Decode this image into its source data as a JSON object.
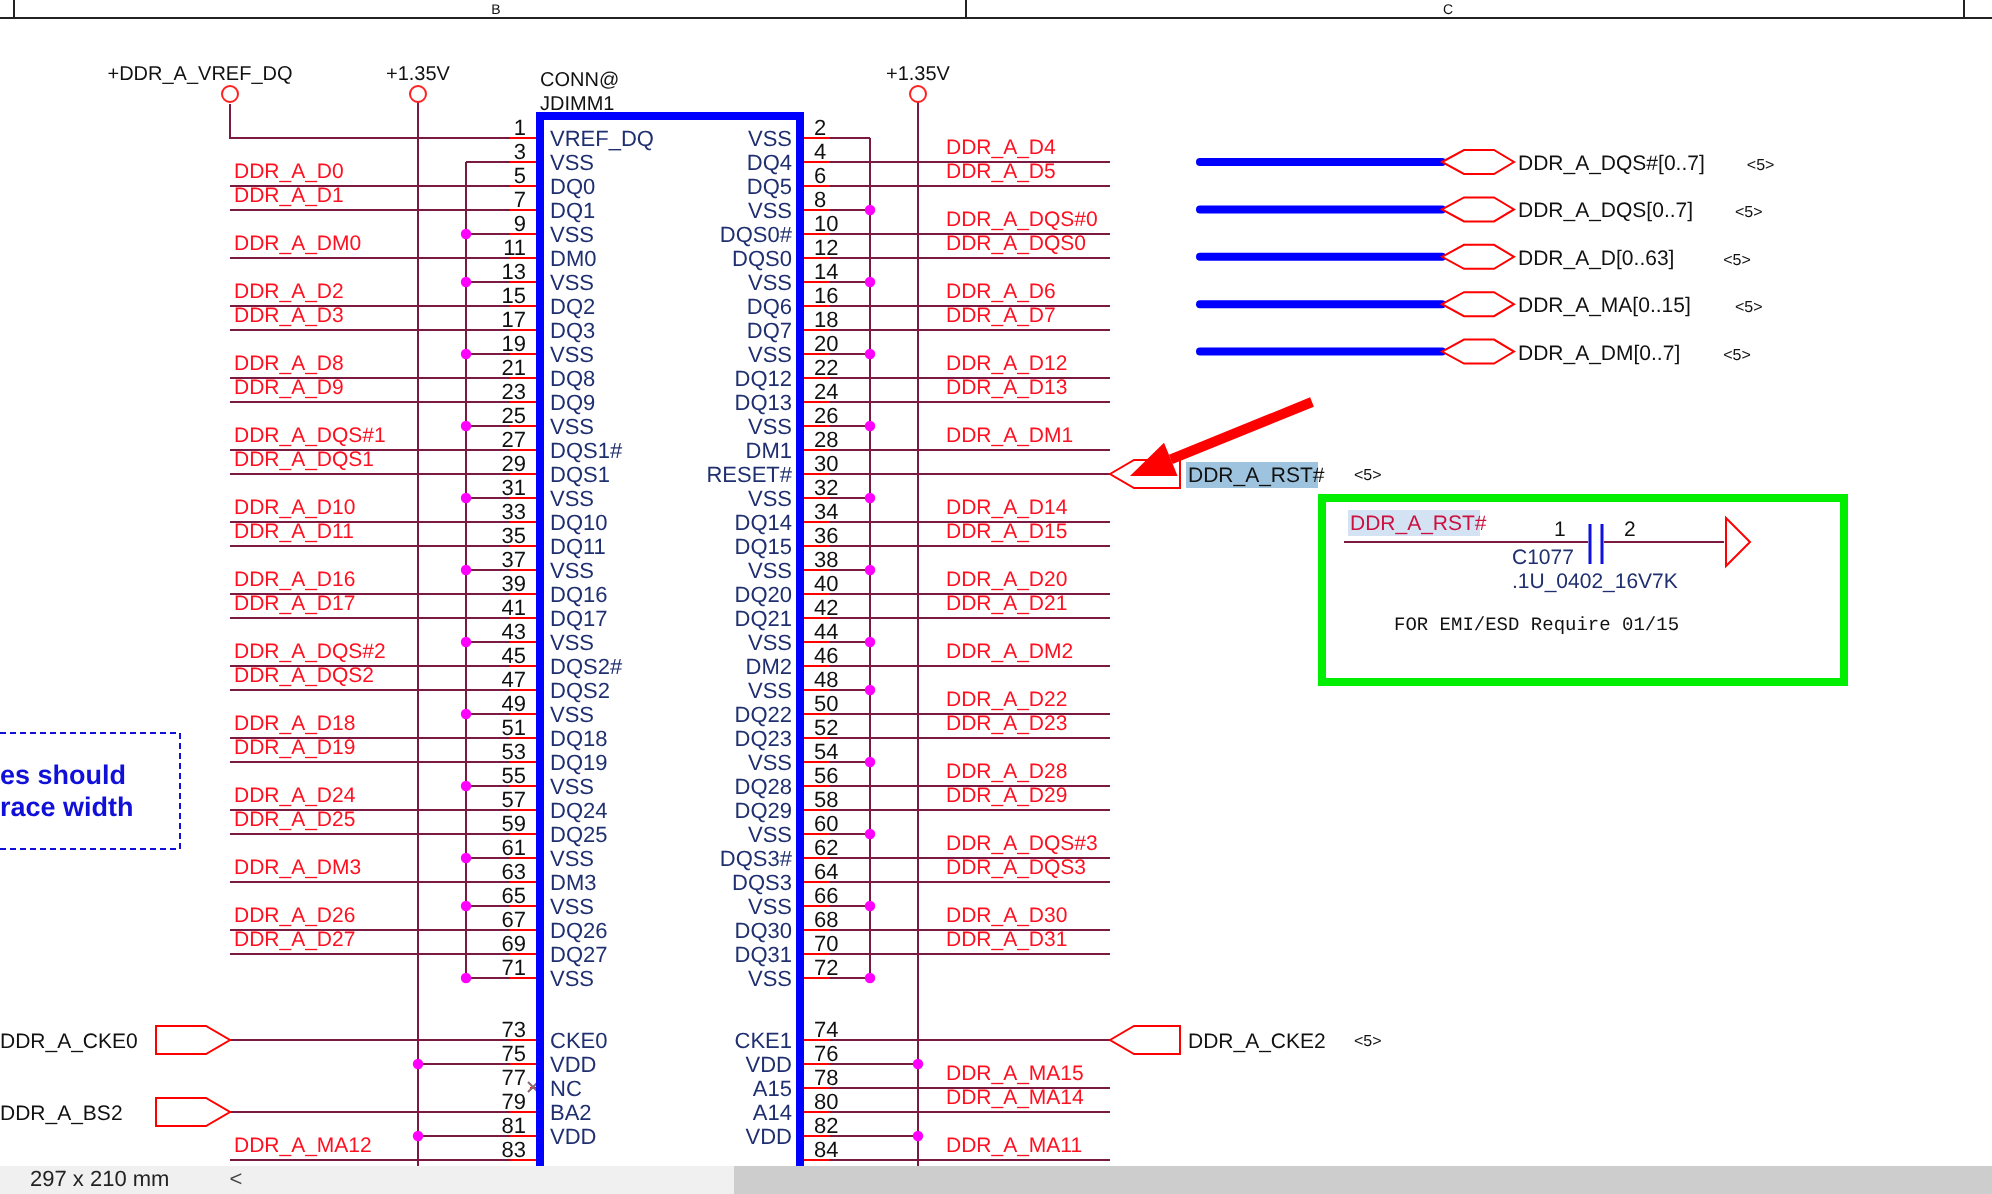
{
  "sheet": {
    "column_headers": [
      "B",
      "C"
    ]
  },
  "component": {
    "ref_tag": "CONN@",
    "designator": "JDIMM1"
  },
  "rails": [
    {
      "kind": "vref",
      "label": "+DDR_A_VREF_DQ"
    },
    {
      "kind": "power",
      "label": "+1.35V"
    },
    {
      "kind": "power",
      "label": "+1.35V"
    }
  ],
  "left_pins": [
    {
      "number": "1",
      "name": "VREF_DQ",
      "kind": "vref"
    },
    {
      "number": "3",
      "name": "VSS",
      "kind": "vss"
    },
    {
      "number": "5",
      "name": "DQ0",
      "kind": "net",
      "net": "DDR_A_D0"
    },
    {
      "number": "7",
      "name": "DQ1",
      "kind": "net",
      "net": "DDR_A_D1"
    },
    {
      "number": "9",
      "name": "VSS",
      "kind": "vss"
    },
    {
      "number": "11",
      "name": "DM0",
      "kind": "net",
      "net": "DDR_A_DM0"
    },
    {
      "number": "13",
      "name": "VSS",
      "kind": "vss"
    },
    {
      "number": "15",
      "name": "DQ2",
      "kind": "net",
      "net": "DDR_A_D2"
    },
    {
      "number": "17",
      "name": "DQ3",
      "kind": "net",
      "net": "DDR_A_D3"
    },
    {
      "number": "19",
      "name": "VSS",
      "kind": "vss"
    },
    {
      "number": "21",
      "name": "DQ8",
      "kind": "net",
      "net": "DDR_A_D8"
    },
    {
      "number": "23",
      "name": "DQ9",
      "kind": "net",
      "net": "DDR_A_D9"
    },
    {
      "number": "25",
      "name": "VSS",
      "kind": "vss"
    },
    {
      "number": "27",
      "name": "DQS1#",
      "kind": "net",
      "net": "DDR_A_DQS#1"
    },
    {
      "number": "29",
      "name": "DQS1",
      "kind": "net",
      "net": "DDR_A_DQS1"
    },
    {
      "number": "31",
      "name": "VSS",
      "kind": "vss"
    },
    {
      "number": "33",
      "name": "DQ10",
      "kind": "net",
      "net": "DDR_A_D10"
    },
    {
      "number": "35",
      "name": "DQ11",
      "kind": "net",
      "net": "DDR_A_D11"
    },
    {
      "number": "37",
      "name": "VSS",
      "kind": "vss"
    },
    {
      "number": "39",
      "name": "DQ16",
      "kind": "net",
      "net": "DDR_A_D16"
    },
    {
      "number": "41",
      "name": "DQ17",
      "kind": "net",
      "net": "DDR_A_D17"
    },
    {
      "number": "43",
      "name": "VSS",
      "kind": "vss"
    },
    {
      "number": "45",
      "name": "DQS2#",
      "kind": "net",
      "net": "DDR_A_DQS#2"
    },
    {
      "number": "47",
      "name": "DQS2",
      "kind": "net",
      "net": "DDR_A_DQS2"
    },
    {
      "number": "49",
      "name": "VSS",
      "kind": "vss"
    },
    {
      "number": "51",
      "name": "DQ18",
      "kind": "net",
      "net": "DDR_A_D18"
    },
    {
      "number": "53",
      "name": "DQ19",
      "kind": "net",
      "net": "DDR_A_D19"
    },
    {
      "number": "55",
      "name": "VSS",
      "kind": "vss"
    },
    {
      "number": "57",
      "name": "DQ24",
      "kind": "net",
      "net": "DDR_A_D24"
    },
    {
      "number": "59",
      "name": "DQ25",
      "kind": "net",
      "net": "DDR_A_D25"
    },
    {
      "number": "61",
      "name": "VSS",
      "kind": "vss"
    },
    {
      "number": "63",
      "name": "DM3",
      "kind": "net",
      "net": "DDR_A_DM3"
    },
    {
      "number": "65",
      "name": "VSS",
      "kind": "vss"
    },
    {
      "number": "67",
      "name": "DQ26",
      "kind": "net",
      "net": "DDR_A_D26"
    },
    {
      "number": "69",
      "name": "DQ27",
      "kind": "net",
      "net": "DDR_A_D27"
    },
    {
      "number": "71",
      "name": "VSS",
      "kind": "vss"
    },
    {
      "number": "73",
      "name": "CKE0",
      "kind": "port",
      "port": {
        "net": "DDR_A_CKE0",
        "highlighted": false
      }
    },
    {
      "number": "75",
      "name": "VDD",
      "kind": "vdd"
    },
    {
      "number": "77",
      "name": "NC",
      "kind": "nc"
    },
    {
      "number": "79",
      "name": "BA2",
      "kind": "port",
      "port": {
        "net": "DDR_A_BS2",
        "highlighted": false
      }
    },
    {
      "number": "81",
      "name": "VDD",
      "kind": "vdd"
    },
    {
      "number": "83",
      "kind": "net",
      "net": "DDR_A_MA12"
    }
  ],
  "right_pins": [
    {
      "number": "2",
      "name": "VSS",
      "kind": "vss"
    },
    {
      "number": "4",
      "name": "DQ4",
      "kind": "net",
      "net": "DDR_A_D4"
    },
    {
      "number": "6",
      "name": "DQ5",
      "kind": "net",
      "net": "DDR_A_D5"
    },
    {
      "number": "8",
      "name": "VSS",
      "kind": "vss"
    },
    {
      "number": "10",
      "name": "DQS0#",
      "kind": "net",
      "net": "DDR_A_DQS#0"
    },
    {
      "number": "12",
      "name": "DQS0",
      "kind": "net",
      "net": "DDR_A_DQS0"
    },
    {
      "number": "14",
      "name": "VSS",
      "kind": "vss"
    },
    {
      "number": "16",
      "name": "DQ6",
      "kind": "net",
      "net": "DDR_A_D6"
    },
    {
      "number": "18",
      "name": "DQ7",
      "kind": "net",
      "net": "DDR_A_D7"
    },
    {
      "number": "20",
      "name": "VSS",
      "kind": "vss"
    },
    {
      "number": "22",
      "name": "DQ12",
      "kind": "net",
      "net": "DDR_A_D12"
    },
    {
      "number": "24",
      "name": "DQ13",
      "kind": "net",
      "net": "DDR_A_D13"
    },
    {
      "number": "26",
      "name": "VSS",
      "kind": "vss"
    },
    {
      "number": "28",
      "name": "DM1",
      "kind": "net",
      "net": "DDR_A_DM1"
    },
    {
      "number": "30",
      "name": "RESET#",
      "kind": "port",
      "port": {
        "net": "DDR_A_RST#",
        "sheet_ref": "<5>",
        "highlighted": true
      }
    },
    {
      "number": "32",
      "name": "VSS",
      "kind": "vss"
    },
    {
      "number": "34",
      "name": "DQ14",
      "kind": "net",
      "net": "DDR_A_D14"
    },
    {
      "number": "36",
      "name": "DQ15",
      "kind": "net",
      "net": "DDR_A_D15"
    },
    {
      "number": "38",
      "name": "VSS",
      "kind": "vss"
    },
    {
      "number": "40",
      "name": "DQ20",
      "kind": "net",
      "net": "DDR_A_D20"
    },
    {
      "number": "42",
      "name": "DQ21",
      "kind": "net",
      "net": "DDR_A_D21"
    },
    {
      "number": "44",
      "name": "VSS",
      "kind": "vss"
    },
    {
      "number": "46",
      "name": "DM2",
      "kind": "net",
      "net": "DDR_A_DM2"
    },
    {
      "number": "48",
      "name": "VSS",
      "kind": "vss"
    },
    {
      "number": "50",
      "name": "DQ22",
      "kind": "net",
      "net": "DDR_A_D22"
    },
    {
      "number": "52",
      "name": "DQ23",
      "kind": "net",
      "net": "DDR_A_D23"
    },
    {
      "number": "54",
      "name": "VSS",
      "kind": "vss"
    },
    {
      "number": "56",
      "name": "DQ28",
      "kind": "net",
      "net": "DDR_A_D28"
    },
    {
      "number": "58",
      "name": "DQ29",
      "kind": "net",
      "net": "DDR_A_D29"
    },
    {
      "number": "60",
      "name": "VSS",
      "kind": "vss"
    },
    {
      "number": "62",
      "name": "DQS3#",
      "kind": "net",
      "net": "DDR_A_DQS#3"
    },
    {
      "number": "64",
      "name": "DQS3",
      "kind": "net",
      "net": "DDR_A_DQS3"
    },
    {
      "number": "66",
      "name": "VSS",
      "kind": "vss"
    },
    {
      "number": "68",
      "name": "DQ30",
      "kind": "net",
      "net": "DDR_A_D30"
    },
    {
      "number": "70",
      "name": "DQ31",
      "kind": "net",
      "net": "DDR_A_D31"
    },
    {
      "number": "72",
      "name": "VSS",
      "kind": "vss"
    },
    {
      "number": "74",
      "name": "CKE1",
      "kind": "port",
      "port": {
        "net": "DDR_A_CKE2",
        "sheet_ref": "<5>",
        "highlighted": false
      }
    },
    {
      "number": "76",
      "name": "VDD",
      "kind": "vdd"
    },
    {
      "number": "78",
      "name": "A15",
      "kind": "net",
      "net": "DDR_A_MA15"
    },
    {
      "number": "80",
      "name": "A14",
      "kind": "net",
      "net": "DDR_A_MA14"
    },
    {
      "number": "82",
      "name": "VDD",
      "kind": "vdd"
    },
    {
      "number": "84",
      "kind": "net",
      "net": "DDR_A_MA11"
    }
  ],
  "buses": [
    {
      "label": "DDR_A_DQS#[0..7]",
      "sheet_ref": "<5>"
    },
    {
      "label": "DDR_A_DQS[0..7]",
      "sheet_ref": "<5>"
    },
    {
      "label": "DDR_A_D[0..63]",
      "sheet_ref": "<5>"
    },
    {
      "label": "DDR_A_MA[0..15]",
      "sheet_ref": "<5>"
    },
    {
      "label": "DDR_A_DM[0..7]",
      "sheet_ref": "<5>"
    }
  ],
  "note_box": {
    "net_label": {
      "text": "DDR_A_RST#",
      "highlighted": true
    },
    "pin_1": "1",
    "pin_2": "2",
    "designator": "C1077",
    "value": ".1U_0402_16V7K",
    "comment": "FOR EMI/ESD Require 01/15"
  },
  "side_note": {
    "lines": [
      "es should",
      "race width"
    ]
  },
  "status_bar": {
    "paper_size": "297 x 210 mm",
    "scroll_left": "<"
  }
}
